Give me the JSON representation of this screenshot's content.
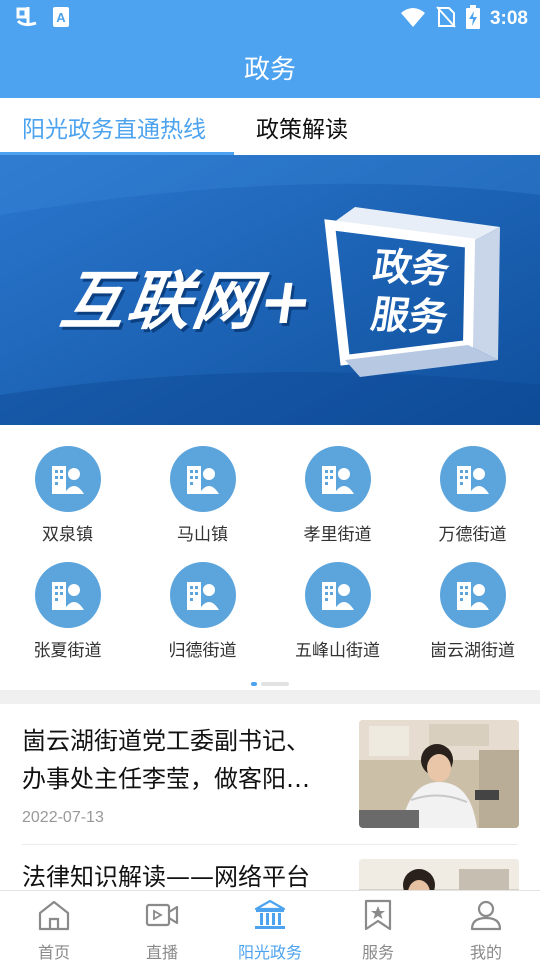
{
  "status_bar": {
    "time": "3:08",
    "icons": [
      "app-logo-icon",
      "keyboard-a-icon",
      "wifi-icon",
      "no-sim-icon",
      "battery-charging-icon"
    ]
  },
  "app_bar": {
    "title": "政务"
  },
  "tabs": [
    {
      "label": "阳光政务直通热线",
      "active": true
    },
    {
      "label": "政策解读",
      "active": false
    }
  ],
  "banner": {
    "main_text": "互联网+",
    "box_line1": "政务",
    "box_line2": "服务"
  },
  "grid": {
    "items": [
      {
        "label": "双泉镇",
        "icon": "building-person-icon"
      },
      {
        "label": "马山镇",
        "icon": "building-person-icon"
      },
      {
        "label": "孝里街道",
        "icon": "building-person-icon"
      },
      {
        "label": "万德街道",
        "icon": "building-person-icon"
      },
      {
        "label": "张夏街道",
        "icon": "building-person-icon"
      },
      {
        "label": "归德街道",
        "icon": "building-person-icon"
      },
      {
        "label": "五峰山街道",
        "icon": "building-person-icon"
      },
      {
        "label": "崮云湖街道",
        "icon": "building-person-icon"
      }
    ]
  },
  "news": {
    "items": [
      {
        "title_line1": "崮云湖街道党工委副书记、",
        "title_line2": "办事处主任李莹，做客阳…",
        "date": "2022-07-13"
      },
      {
        "title_line1": "法律知识解读——网络平台",
        "title_line2": "",
        "date": ""
      }
    ]
  },
  "bottom_nav": {
    "items": [
      {
        "label": "首页",
        "icon": "home-icon",
        "active": false
      },
      {
        "label": "直播",
        "icon": "video-camera-icon",
        "active": false
      },
      {
        "label": "阳光政务",
        "icon": "government-building-icon",
        "active": true
      },
      {
        "label": "服务",
        "icon": "bookmark-star-icon",
        "active": false
      },
      {
        "label": "我的",
        "icon": "person-icon",
        "active": false
      }
    ]
  },
  "colors": {
    "primary": "#4da3ef",
    "icon_circle": "#5ca5dc",
    "banner": "#1a64bc"
  }
}
